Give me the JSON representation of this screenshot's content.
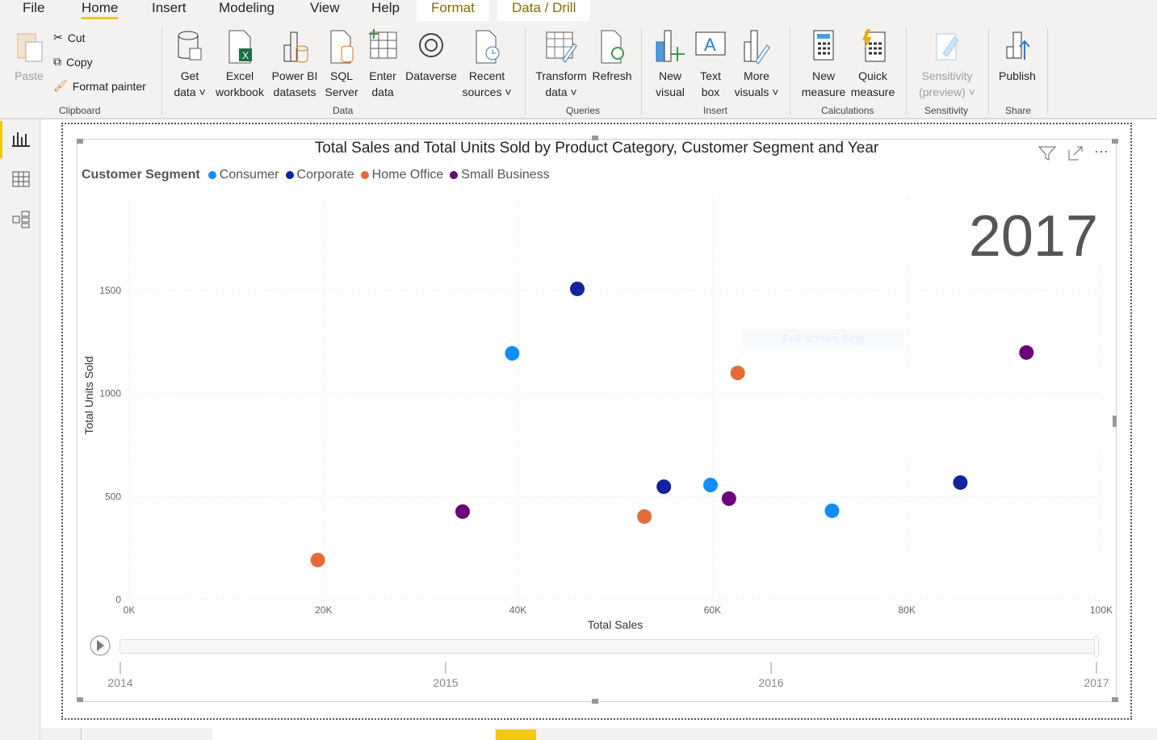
{
  "menu": {
    "tabs": [
      "File",
      "Home",
      "Insert",
      "Modeling",
      "View",
      "Help"
    ],
    "context_tabs": [
      "Format",
      "Data / Drill"
    ],
    "active": "Home"
  },
  "ribbon": {
    "clipboard": {
      "paste": "Paste",
      "cut": "Cut",
      "copy": "Copy",
      "format_painter": "Format painter",
      "label": "Clipboard"
    },
    "data": {
      "get_data": [
        "Get",
        "data"
      ],
      "excel": [
        "Excel",
        "workbook"
      ],
      "pbi": [
        "Power BI",
        "datasets"
      ],
      "sql": [
        "SQL",
        "Server"
      ],
      "enter": [
        "Enter",
        "data"
      ],
      "dataverse": "Dataverse",
      "recent": [
        "Recent",
        "sources"
      ],
      "label": "Data"
    },
    "queries": {
      "transform": [
        "Transform",
        "data"
      ],
      "refresh": "Refresh",
      "label": "Queries"
    },
    "insert": {
      "new_visual": [
        "New",
        "visual"
      ],
      "text_box": [
        "Text",
        "box"
      ],
      "more": [
        "More",
        "visuals"
      ],
      "label": "Insert"
    },
    "calculations": {
      "new_measure": [
        "New",
        "measure"
      ],
      "quick_measure": [
        "Quick",
        "measure"
      ],
      "label": "Calculations"
    },
    "sensitivity": {
      "btn": [
        "Sensitivity",
        "(preview)"
      ],
      "label": "Sensitivity"
    },
    "share": {
      "publish": "Publish",
      "label": "Share"
    }
  },
  "overlay_text": "Full-screen Snip",
  "chart_data": {
    "type": "scatter",
    "title": "Total Sales and Total Units Sold by Product Category, Customer Segment and Year",
    "legend_title": "Customer Segment",
    "legend_position": "top-left",
    "xlabel": "Total Sales",
    "ylabel": "Total Units Sold",
    "xlim": [
      0,
      100000
    ],
    "ylim": [
      0,
      1950
    ],
    "xticks": [
      {
        "v": 0,
        "label": "0K"
      },
      {
        "v": 20000,
        "label": "20K"
      },
      {
        "v": 40000,
        "label": "40K"
      },
      {
        "v": 60000,
        "label": "60K"
      },
      {
        "v": 80000,
        "label": "80K"
      },
      {
        "v": 100000,
        "label": "100K"
      }
    ],
    "yticks": [
      {
        "v": 0,
        "label": "0"
      },
      {
        "v": 500,
        "label": "500"
      },
      {
        "v": 1000,
        "label": "1000"
      },
      {
        "v": 1500,
        "label": "1500"
      }
    ],
    "grid": true,
    "play_axis": {
      "current": "2017",
      "ticks": [
        "2014",
        "2015",
        "2016",
        "2017"
      ]
    },
    "series": [
      {
        "name": "Consumer",
        "color": "#118DFF",
        "points": [
          [
            39400,
            1195
          ],
          [
            59800,
            556
          ],
          [
            72300,
            431
          ]
        ]
      },
      {
        "name": "Corporate",
        "color": "#12239E",
        "points": [
          [
            46100,
            1508
          ],
          [
            55000,
            548
          ],
          [
            85500,
            568
          ]
        ]
      },
      {
        "name": "Home Office",
        "color": "#E66C37",
        "points": [
          [
            19400,
            192
          ],
          [
            53000,
            403
          ],
          [
            62600,
            1100
          ]
        ]
      },
      {
        "name": "Small Business",
        "color": "#6B007B",
        "points": [
          [
            34300,
            427
          ],
          [
            61700,
            490
          ],
          [
            92300,
            1199
          ]
        ]
      }
    ]
  }
}
